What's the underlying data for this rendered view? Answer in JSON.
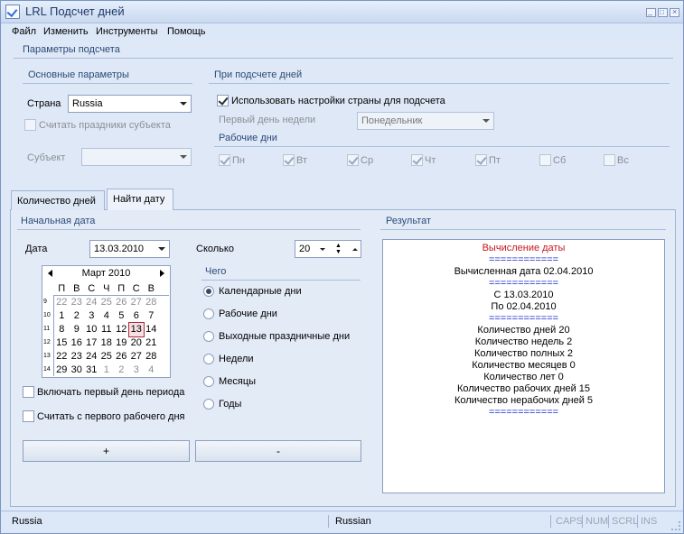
{
  "window": {
    "title": "LRL Подсчет дней"
  },
  "menu": [
    "Файл",
    "Изменить",
    "Инструменты",
    "Помощь"
  ],
  "params": {
    "title": "Параметры подсчета",
    "basic_title": "Основные параметры",
    "country_label": "Страна",
    "country_value": "Russia",
    "count_holidays_label": "Считать праздники субъекта",
    "subject_label": "Субъект",
    "subject_value": "",
    "counting_title": "При подсчете дней",
    "use_country_settings_label": "Использовать настройки страны для подсчета",
    "first_weekday_label": "Первый день недели",
    "first_weekday_value": "Понедельник",
    "workdays_title": "Рабочие дни",
    "weekdays": [
      {
        "label": "Пн",
        "checked": true
      },
      {
        "label": "Вт",
        "checked": true
      },
      {
        "label": "Ср",
        "checked": true
      },
      {
        "label": "Чт",
        "checked": true
      },
      {
        "label": "Пт",
        "checked": true
      },
      {
        "label": "Сб",
        "checked": false
      },
      {
        "label": "Вс",
        "checked": false
      }
    ]
  },
  "tabs": [
    "Количество дней",
    "Найти дату"
  ],
  "find_date": {
    "start_title": "Начальная дата",
    "date_label": "Дата",
    "date_value": "13.03.2010",
    "calendar": {
      "month": "Март 2010",
      "weekday_headers": [
        "П",
        "В",
        "С",
        "Ч",
        "П",
        "С",
        "В"
      ],
      "week_numbers": [
        "9",
        "10",
        "11",
        "12",
        "13",
        "14"
      ],
      "days": [
        "22",
        "23",
        "24",
        "25",
        "26",
        "27",
        "28",
        "1",
        "2",
        "3",
        "4",
        "5",
        "6",
        "7",
        "8",
        "9",
        "10",
        "11",
        "12",
        "13",
        "14",
        "15",
        "16",
        "17",
        "18",
        "19",
        "20",
        "21",
        "22",
        "23",
        "24",
        "25",
        "26",
        "27",
        "28",
        "29",
        "30",
        "31",
        "1",
        "2",
        "3",
        "4"
      ],
      "selected_day": "13"
    },
    "include_first_label": "Включать первый день периода",
    "from_first_workday_label": "Считать с первого рабочего дня",
    "amount_label": "Сколько",
    "amount_value": "20",
    "what_title": "Чего",
    "units": [
      {
        "label": "Календарные дни",
        "selected": true
      },
      {
        "label": "Рабочие дни",
        "selected": false
      },
      {
        "label": "Выходные праздничные дни",
        "selected": false
      },
      {
        "label": "Недели",
        "selected": false
      },
      {
        "label": "Месяцы",
        "selected": false
      },
      {
        "label": "Годы",
        "selected": false
      }
    ],
    "plus_label": "+",
    "minus_label": "-"
  },
  "result": {
    "title": "Результат",
    "lines": [
      "Вычисление даты",
      "============",
      "Вычисленная дата 02.04.2010",
      "============",
      "С 13.03.2010",
      "По 02.04.2010",
      "============",
      "Количество дней 20",
      "Количество недель 2",
      "Количество полных 2",
      "Количество месяцев 0",
      "Количество лет 0",
      "Количество рабочих дней 15",
      "Количество нерабочих дней 5",
      "============"
    ]
  },
  "status": {
    "country": "Russia",
    "language": "Russian",
    "caps": "CAPS",
    "num": "NUM",
    "scrl": "SCRL",
    "ins": "INS"
  },
  "colors": {
    "window_bg": "#dfe8f6",
    "accent_title": "#2a4a7a",
    "result_title": "#c8161c",
    "result_separator": "#1a2cc8",
    "selected_day_outline": "#b02a3a"
  }
}
